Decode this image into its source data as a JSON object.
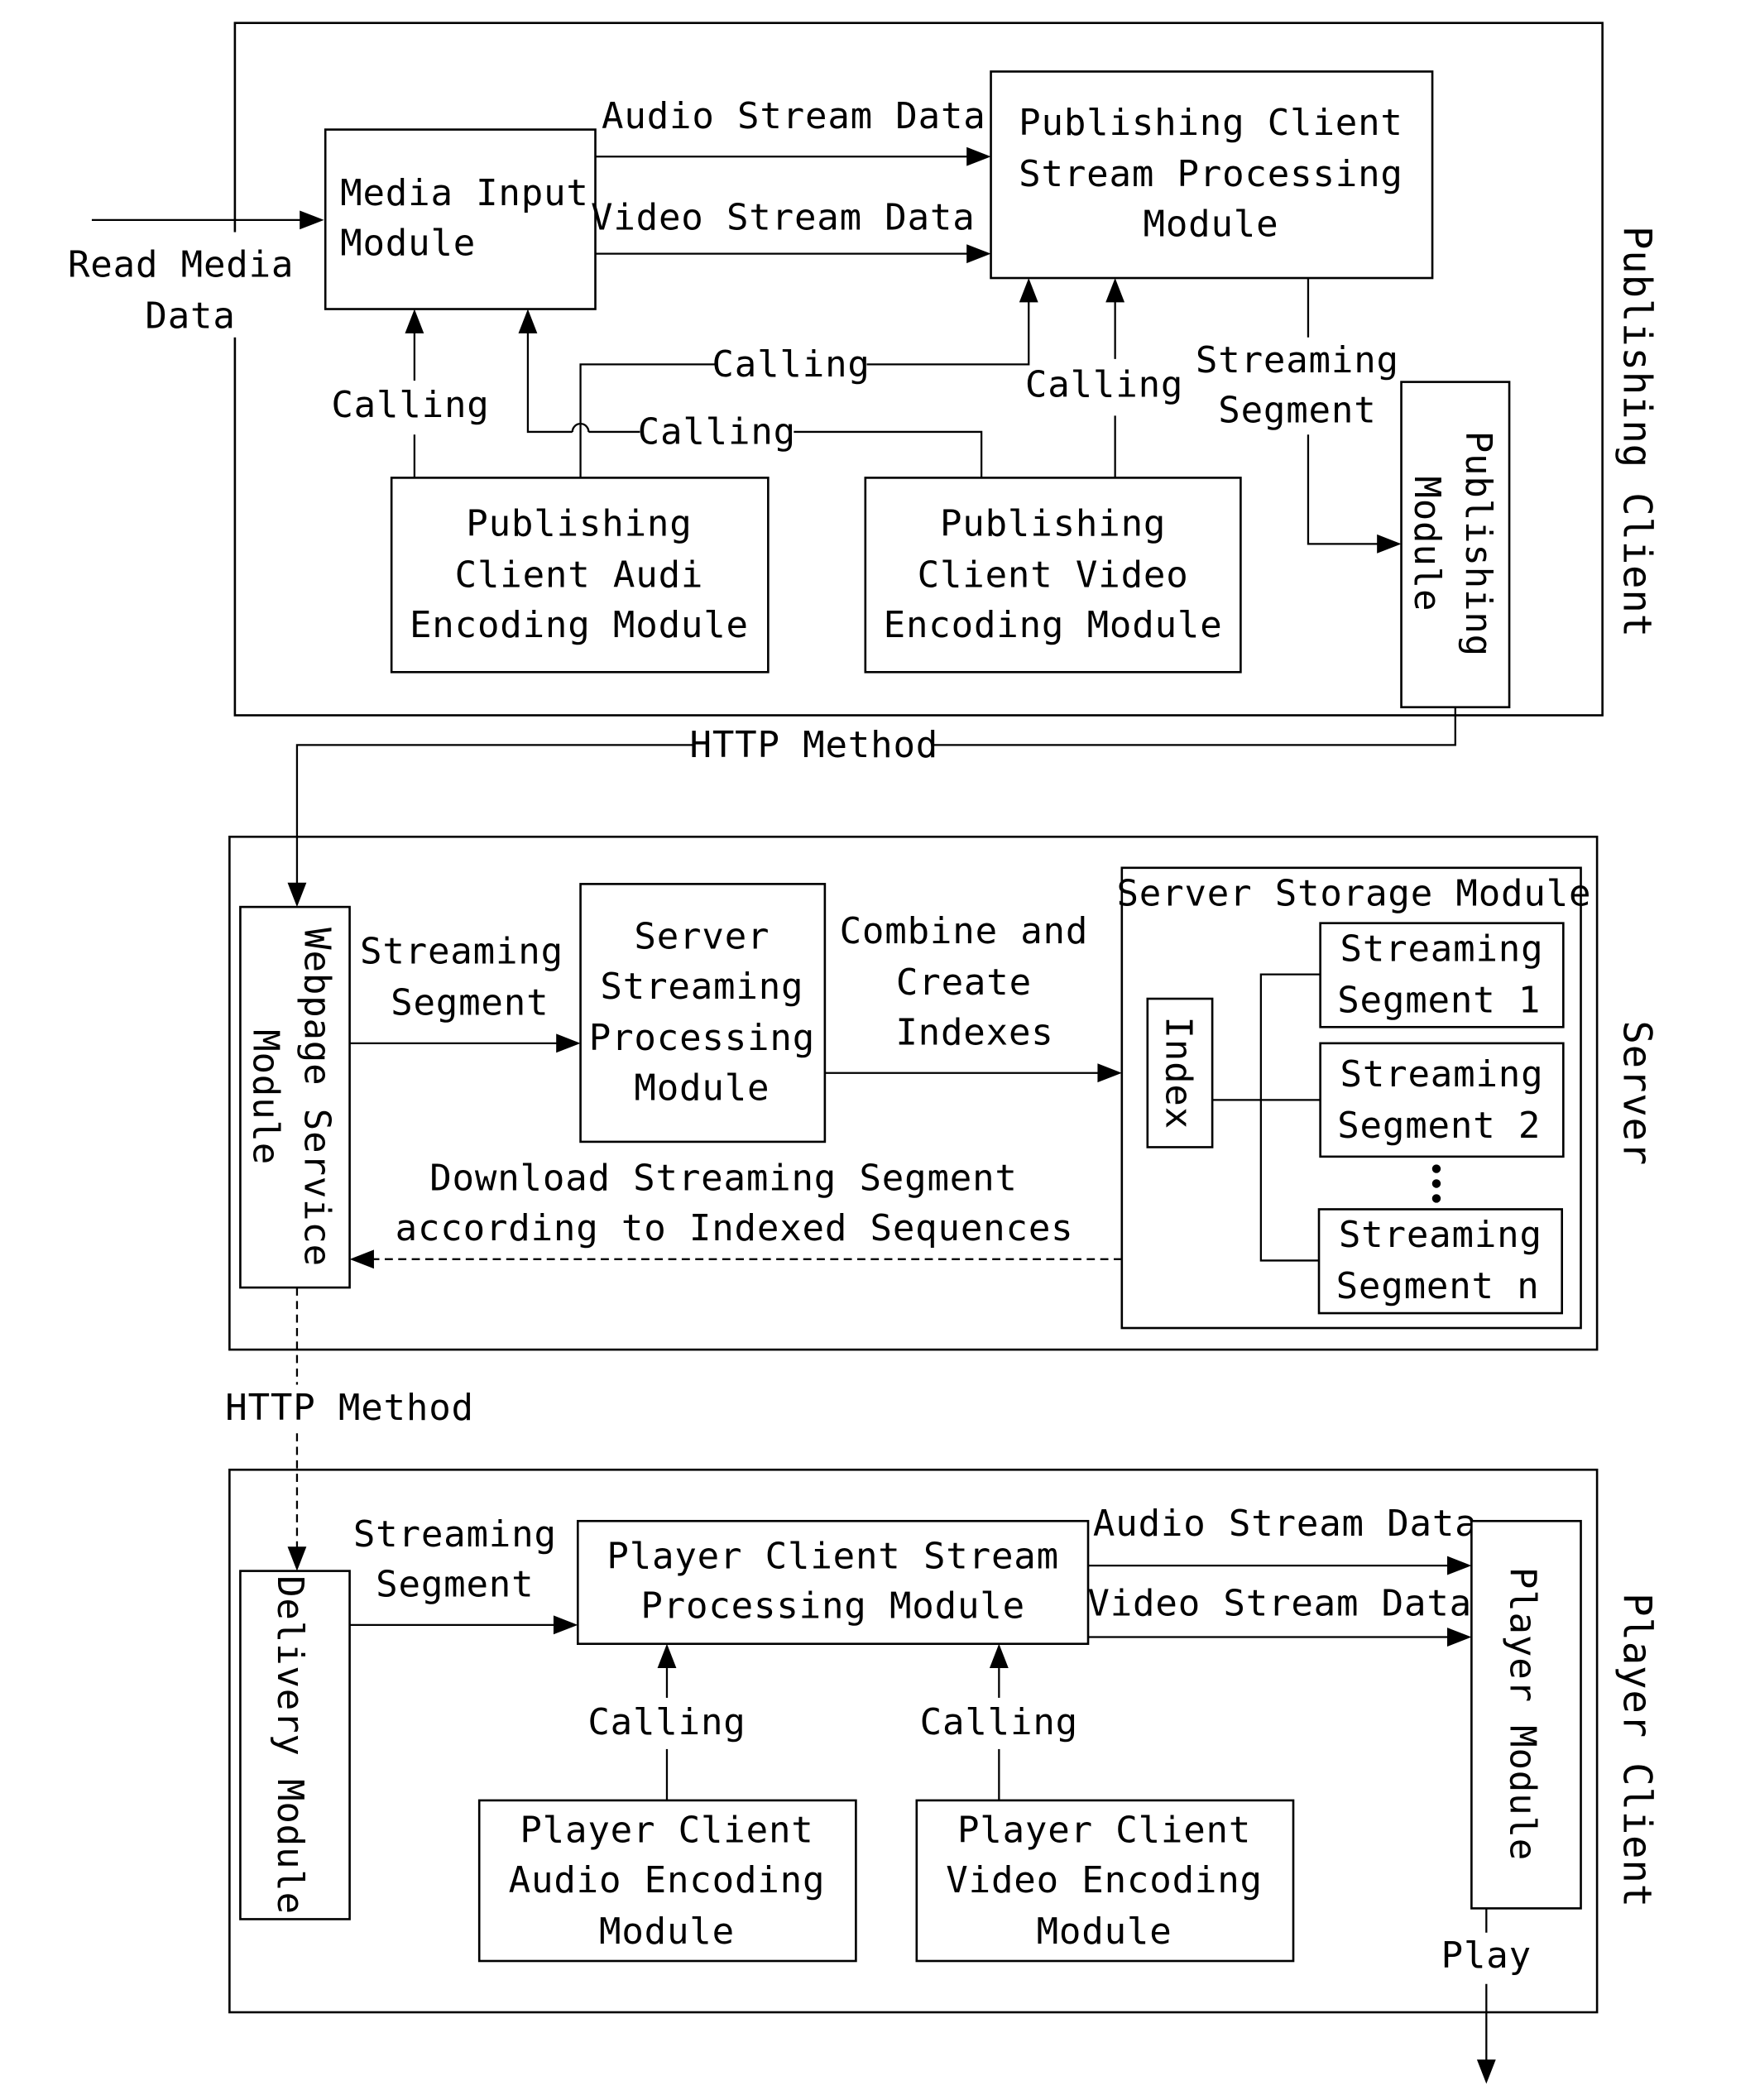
{
  "sections": {
    "publishing_client": "Publishing Client",
    "server": "Server",
    "player_client": "Player Client"
  },
  "publishing": {
    "read_media_data": [
      "Read Media",
      "Data"
    ],
    "media_input_module": [
      "Media Input",
      "Module"
    ],
    "audio_stream_data": "Audio Stream Data",
    "video_stream_data": "Video Stream Data",
    "stream_processing_module": [
      "Publishing Client",
      "Stream Processing",
      "Module"
    ],
    "calling_left": "Calling",
    "calling_top": "Calling",
    "calling_mid": "Calling",
    "calling_right": "Calling",
    "streaming_segment": [
      "Streaming",
      "Segment"
    ],
    "publishing_module": [
      "Publishing",
      "Module"
    ],
    "audio_encoding_module": [
      "Publishing",
      "Client Audi",
      "Encoding Module"
    ],
    "video_encoding_module": [
      "Publishing",
      "Client Video",
      "Encoding Module"
    ]
  },
  "links": {
    "http_method_top": "HTTP Method",
    "http_method_bottom": "HTTP Method"
  },
  "server": {
    "webpage_service_module": [
      "Webpage Service",
      "Module"
    ],
    "streaming_segment": [
      "Streaming",
      "Segment"
    ],
    "server_streaming_processing_module": [
      "Server",
      "Streaming",
      "Processing",
      "Module"
    ],
    "combine_create_indexes": [
      "Combine and",
      "Create",
      "Indexes"
    ],
    "download_label": [
      "Download Streaming Segment",
      "according to Indexed Sequences"
    ],
    "storage_module_title": "Server Storage Module",
    "index": "Index",
    "segments": [
      [
        "Streaming",
        "Segment 1"
      ],
      [
        "Streaming",
        "Segment 2"
      ],
      [
        "Streaming",
        "Segment n"
      ]
    ]
  },
  "player": {
    "delivery_module": "Delivery Module",
    "streaming_segment": [
      "Streaming",
      "Segment"
    ],
    "stream_processing_module": [
      "Player Client Stream",
      "Processing Module"
    ],
    "audio_stream_data": "Audio Stream Data",
    "video_stream_data": "Video Stream Data",
    "player_module": "Player Module",
    "calling_left": "Calling",
    "calling_right": "Calling",
    "audio_encoding_module": [
      "Player Client",
      "Audio Encoding",
      "Module"
    ],
    "video_encoding_module": [
      "Player Client",
      "Video Encoding",
      "Module"
    ],
    "play": "Play"
  }
}
